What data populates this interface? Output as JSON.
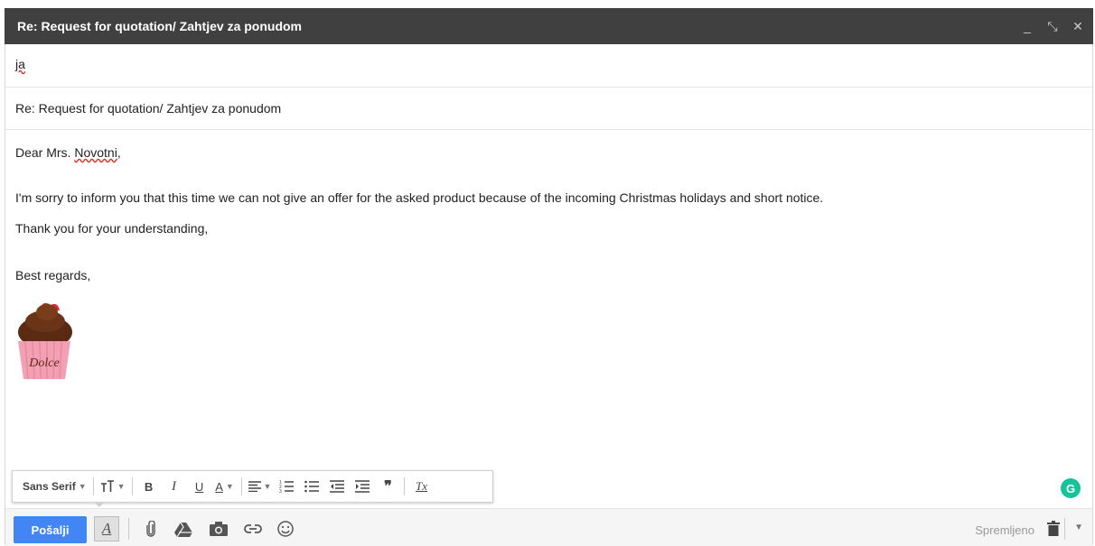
{
  "window": {
    "title": "Re: Request for quotation/ Zahtjev za ponudom",
    "minimize": "_",
    "popout": "⤡",
    "close": "✕"
  },
  "to": {
    "recipient": "ja"
  },
  "subject": {
    "value": "Re: Request for quotation/ Zahtjev za ponudom"
  },
  "body": {
    "greeting_prefix": "Dear Mrs. ",
    "greeting_name": "Novotni",
    "greeting_suffix": ",",
    "para1": "I'm sorry to inform you that this time we can not give an offer for the asked product because of the incoming Christmas holidays and short notice.",
    "para2": "Thank you for your understanding,",
    "closing": "Best regards,",
    "signature_logo_text": "Dolce"
  },
  "format_toolbar": {
    "font": "Sans Serif",
    "caret": "▼",
    "size_icon": "size-icon",
    "bold": "B",
    "italic": "I",
    "underline": "U",
    "text_color": "A",
    "quote": "❞",
    "clear": "Tx"
  },
  "bottom_bar": {
    "send_label": "Pošalji",
    "saved_label": "Spremljeno",
    "more_caret": "▼"
  },
  "grammarly": {
    "letter": "G"
  },
  "colors": {
    "titlebar": "#404040",
    "send": "#4285f4",
    "grammarly": "#15c39a",
    "spell": "#d93025"
  }
}
